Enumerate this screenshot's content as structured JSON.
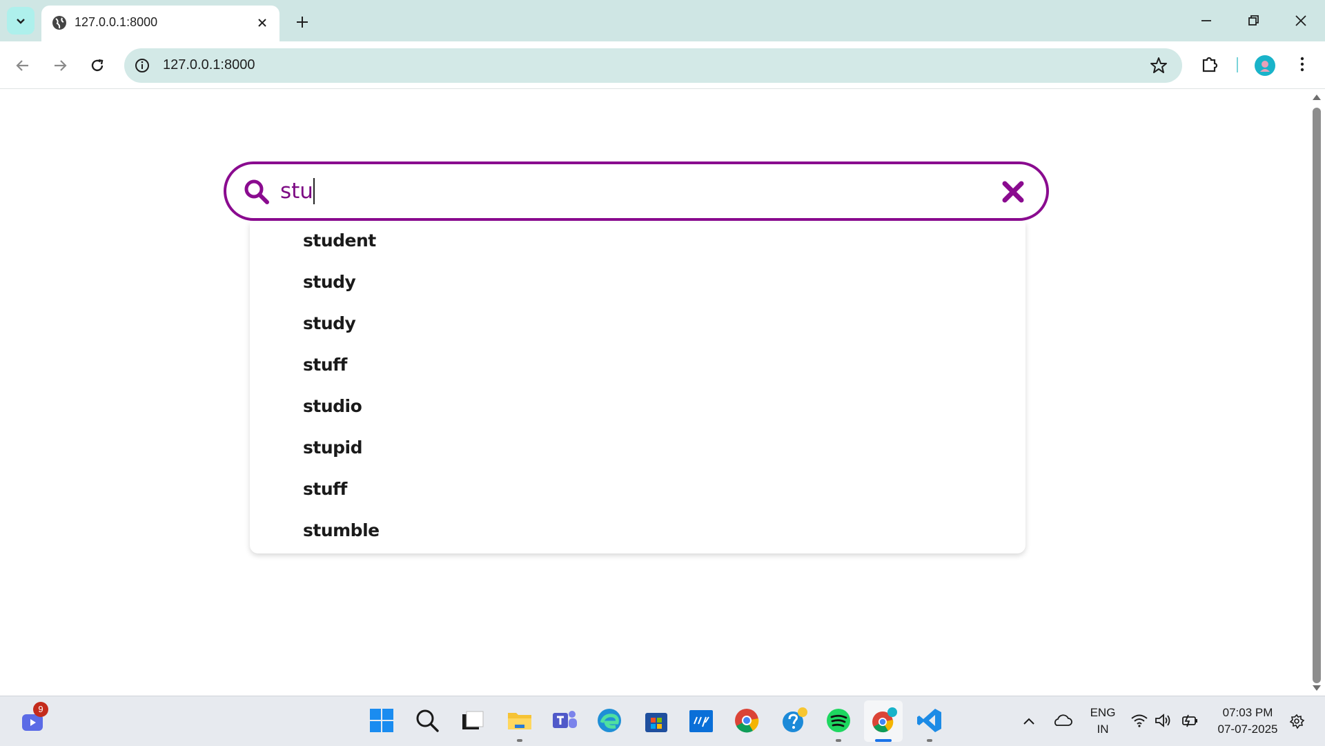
{
  "browser": {
    "tab_title": "127.0.0.1:8000",
    "url": "127.0.0.1:8000"
  },
  "search": {
    "query": "stu",
    "suggestions": [
      "student",
      "study",
      "study",
      "stuff",
      "studio",
      "stupid",
      "stuff",
      "stumble"
    ]
  },
  "taskbar": {
    "notification_count": "9",
    "language": "ENG",
    "region": "IN",
    "time": "07:03 PM",
    "date": "07-07-2025"
  },
  "colors": {
    "accent": "#8a0b8f",
    "chrome_bg": "#cfe6e4",
    "omnibox_bg": "#d3e9e7"
  }
}
